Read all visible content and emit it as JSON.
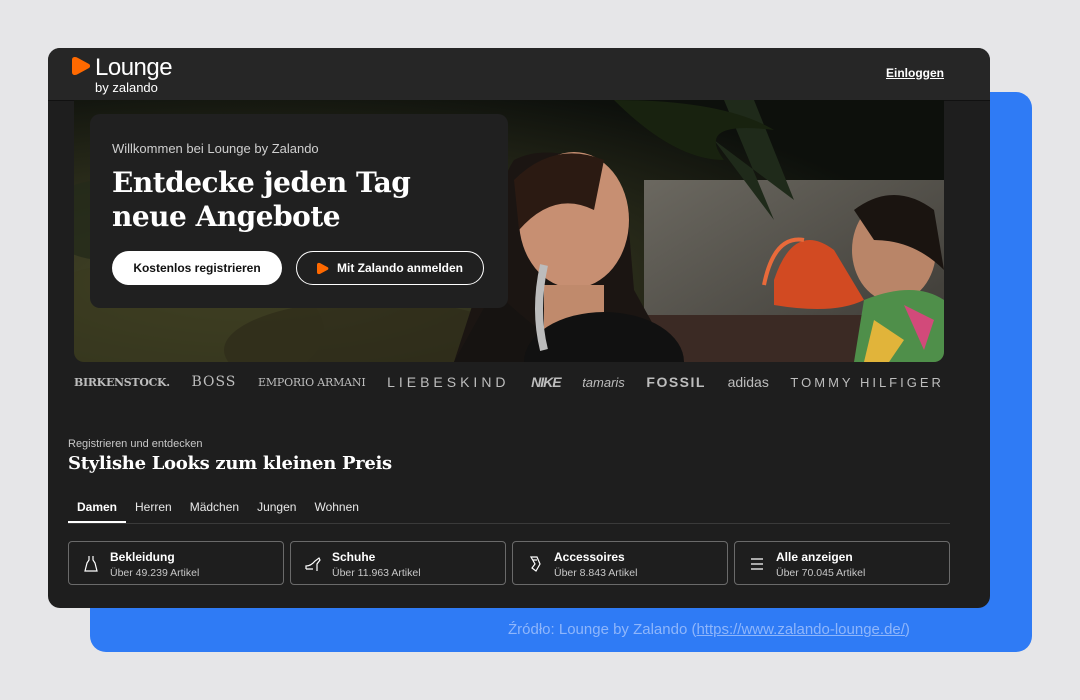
{
  "header": {
    "logo_word": "Lounge",
    "logo_sub": "by zalando",
    "login_label": "Einloggen"
  },
  "hero": {
    "kicker": "Willkommen bei Lounge by Zalando",
    "title": "Entdecke jeden Tag neue Angebote",
    "register_button": "Kostenlos registrieren",
    "zalando_button": "Mit Zalando anmelden"
  },
  "brands": [
    "BIRKENSTOCK.",
    "BOSS",
    "EMPORIO ARMANI",
    "LIEBESKIND",
    "NIKE",
    "tamaris",
    "FOSSIL",
    "adidas",
    "TOMMY HILFIGER"
  ],
  "section": {
    "kicker": "Registrieren und entdecken",
    "title": "Stylishe Looks zum kleinen Preis"
  },
  "tabs": [
    {
      "label": "Damen",
      "active": true
    },
    {
      "label": "Herren",
      "active": false
    },
    {
      "label": "Mädchen",
      "active": false
    },
    {
      "label": "Jungen",
      "active": false
    },
    {
      "label": "Wohnen",
      "active": false
    }
  ],
  "categories": [
    {
      "name": "Bekleidung",
      "count": "Über 49.239 Artikel",
      "icon": "dress-icon"
    },
    {
      "name": "Schuhe",
      "count": "Über 11.963 Artikel",
      "icon": "shoe-icon"
    },
    {
      "name": "Accessoires",
      "count": "Über 8.843 Artikel",
      "icon": "accessory-icon"
    },
    {
      "name": "Alle anzeigen",
      "count": "Über 70.045 Artikel",
      "icon": "list-icon"
    }
  ],
  "caption": {
    "text": "Źródło: Lounge by Zalando (",
    "link": "https://www.zalando-lounge.de/",
    "end": ")"
  },
  "colors": {
    "accent": "#ff6900",
    "background": "#1e1e1e",
    "panel": "#2f7bf5"
  }
}
